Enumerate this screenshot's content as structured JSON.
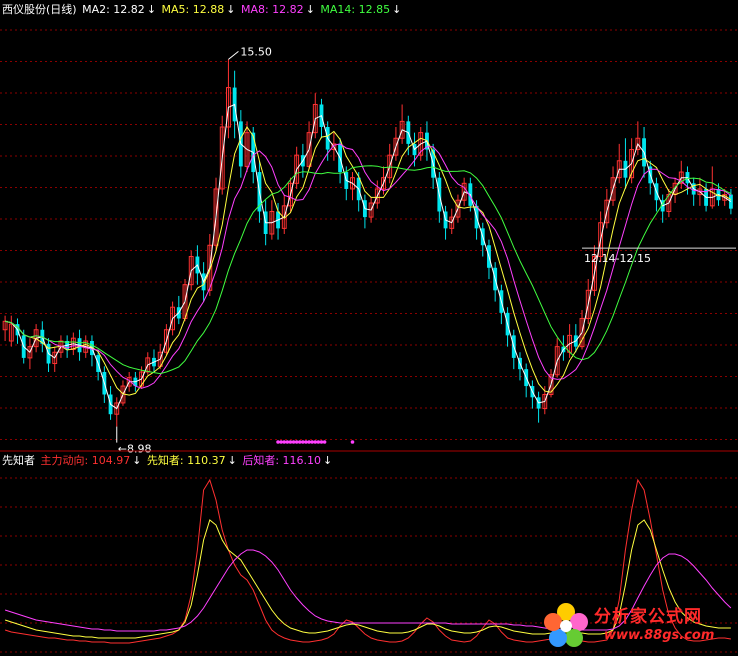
{
  "main_legend": {
    "title": "西仪股份(日线)",
    "items": [
      {
        "label": "MA2: 12.82",
        "color": "#ffffff"
      },
      {
        "label": "MA5: 12.88",
        "color": "#ffff40"
      },
      {
        "label": "MA8: 12.82",
        "color": "#ff40ff"
      },
      {
        "label": "MA14: 12.85",
        "color": "#40ff40"
      }
    ],
    "arrow": "↓"
  },
  "sub_legend": {
    "title": "先知者",
    "items": [
      {
        "label": "主力动向: 104.97",
        "color": "#ff3030"
      },
      {
        "label": "先知者: 110.37",
        "color": "#ffff40"
      },
      {
        "label": "后知者: 116.10",
        "color": "#ff40ff"
      }
    ],
    "arrow": "↓"
  },
  "annotations": {
    "high_label": "15.50",
    "low_label": "8.98",
    "range_label": "12.14-12.15"
  },
  "watermark": {
    "text": "分析家公式网",
    "url": "www.88gs.com"
  },
  "colors": {
    "up": "#ff3232",
    "down": "#00e5ee",
    "grid": "#8b0000",
    "divider": "#aa0000",
    "ma2": "#ffffff",
    "ma5": "#ffff40",
    "ma8": "#ff40ff",
    "ma14": "#40ff40",
    "main_force": "#ff3030",
    "prophet": "#ffff40",
    "follower": "#ff40ff",
    "dots": "#ff40ff"
  },
  "chart_data": [
    {
      "type": "candlestick",
      "title": "西仪股份(日线)",
      "ylim": [
        8.6,
        16.2
      ],
      "candles": [
        [
          10.7,
          10.85,
          10.5,
          10.95
        ],
        [
          10.5,
          10.8,
          10.4,
          10.95
        ],
        [
          10.8,
          10.6,
          10.45,
          10.9
        ],
        [
          10.6,
          10.2,
          10.1,
          10.7
        ],
        [
          10.2,
          10.4,
          10.0,
          10.55
        ],
        [
          10.4,
          10.7,
          10.3,
          10.8
        ],
        [
          10.7,
          10.45,
          10.3,
          10.85
        ],
        [
          10.45,
          10.1,
          9.95,
          10.55
        ],
        [
          10.1,
          10.3,
          9.95,
          10.4
        ],
        [
          10.3,
          10.5,
          10.2,
          10.6
        ],
        [
          10.5,
          10.35,
          10.2,
          10.6
        ],
        [
          10.35,
          10.55,
          10.25,
          10.65
        ],
        [
          10.55,
          10.3,
          10.15,
          10.7
        ],
        [
          10.3,
          10.5,
          10.2,
          10.6
        ],
        [
          10.5,
          10.25,
          10.05,
          10.6
        ],
        [
          10.25,
          9.95,
          9.8,
          10.35
        ],
        [
          9.95,
          9.55,
          9.4,
          10.05
        ],
        [
          9.55,
          9.2,
          9.1,
          9.7
        ],
        [
          9.2,
          9.4,
          8.98,
          9.5
        ],
        [
          9.4,
          9.7,
          9.35,
          9.8
        ],
        [
          9.7,
          9.85,
          9.6,
          9.95
        ],
        [
          9.85,
          9.7,
          9.6,
          9.95
        ],
        [
          9.7,
          9.95,
          9.65,
          10.05
        ],
        [
          9.95,
          10.2,
          9.9,
          10.3
        ],
        [
          10.2,
          10.05,
          9.95,
          10.35
        ],
        [
          10.05,
          10.3,
          10.0,
          10.45
        ],
        [
          10.3,
          10.7,
          10.25,
          10.8
        ],
        [
          10.7,
          11.1,
          10.6,
          11.2
        ],
        [
          11.1,
          10.9,
          10.8,
          11.3
        ],
        [
          10.9,
          11.5,
          10.85,
          11.6
        ],
        [
          11.5,
          12.0,
          11.4,
          12.1
        ],
        [
          12.0,
          11.7,
          11.5,
          12.2
        ],
        [
          11.7,
          11.4,
          11.2,
          11.9
        ],
        [
          11.4,
          12.2,
          11.3,
          12.4
        ],
        [
          12.2,
          13.2,
          12.1,
          13.4
        ],
        [
          13.2,
          14.3,
          13.1,
          14.5
        ],
        [
          14.3,
          15.0,
          14.1,
          15.5
        ],
        [
          15.0,
          14.4,
          14.1,
          15.3
        ],
        [
          14.4,
          13.6,
          13.4,
          14.6
        ],
        [
          13.6,
          14.2,
          13.5,
          14.4
        ],
        [
          14.2,
          13.5,
          13.3,
          14.3
        ],
        [
          13.5,
          12.8,
          12.6,
          13.7
        ],
        [
          12.8,
          12.4,
          12.2,
          13.0
        ],
        [
          12.4,
          12.8,
          12.3,
          13.0
        ],
        [
          12.8,
          12.5,
          12.3,
          12.95
        ],
        [
          12.5,
          12.9,
          12.4,
          13.1
        ],
        [
          12.9,
          13.3,
          12.8,
          13.4
        ],
        [
          13.3,
          13.8,
          13.2,
          13.95
        ],
        [
          13.8,
          13.6,
          13.4,
          14.0
        ],
        [
          13.6,
          14.2,
          13.55,
          14.4
        ],
        [
          14.2,
          14.7,
          14.1,
          14.9
        ],
        [
          14.7,
          14.3,
          14.1,
          14.8
        ],
        [
          14.3,
          13.9,
          13.7,
          14.4
        ],
        [
          13.9,
          14.0,
          13.7,
          14.2
        ],
        [
          14.0,
          13.5,
          13.3,
          14.1
        ],
        [
          13.5,
          13.2,
          13.0,
          13.6
        ],
        [
          13.2,
          13.4,
          13.0,
          13.5
        ],
        [
          13.4,
          13.0,
          12.8,
          13.5
        ],
        [
          13.0,
          12.7,
          12.5,
          13.1
        ],
        [
          12.7,
          12.95,
          12.6,
          13.05
        ],
        [
          12.95,
          13.2,
          12.85,
          13.35
        ],
        [
          13.2,
          13.4,
          13.1,
          13.6
        ],
        [
          13.4,
          13.8,
          13.3,
          14.0
        ],
        [
          13.8,
          14.1,
          13.7,
          14.3
        ],
        [
          14.1,
          14.4,
          14.0,
          14.7
        ],
        [
          14.4,
          14.0,
          13.8,
          14.5
        ],
        [
          14.0,
          13.8,
          13.6,
          14.2
        ],
        [
          13.8,
          14.2,
          13.7,
          14.3
        ],
        [
          14.2,
          13.9,
          13.7,
          14.4
        ],
        [
          13.9,
          13.4,
          13.2,
          14.0
        ],
        [
          13.4,
          12.8,
          12.6,
          13.5
        ],
        [
          12.8,
          12.5,
          12.3,
          12.9
        ],
        [
          12.5,
          12.7,
          12.4,
          12.85
        ],
        [
          12.7,
          13.0,
          12.6,
          13.1
        ],
        [
          13.0,
          13.3,
          12.9,
          13.4
        ],
        [
          13.3,
          12.9,
          12.8,
          13.4
        ],
        [
          12.9,
          12.5,
          12.3,
          13.0
        ],
        [
          12.5,
          12.2,
          12.0,
          12.6
        ],
        [
          12.2,
          11.8,
          11.6,
          12.3
        ],
        [
          11.8,
          11.4,
          11.2,
          11.9
        ],
        [
          11.4,
          11.0,
          10.8,
          11.5
        ],
        [
          11.0,
          10.6,
          10.4,
          11.1
        ],
        [
          10.6,
          10.2,
          10.0,
          10.7
        ],
        [
          10.2,
          10.0,
          9.8,
          10.3
        ],
        [
          10.0,
          9.7,
          9.5,
          10.1
        ],
        [
          9.7,
          9.5,
          9.3,
          9.8
        ],
        [
          9.5,
          9.3,
          9.05,
          9.6
        ],
        [
          9.3,
          9.55,
          9.2,
          9.7
        ],
        [
          9.55,
          9.9,
          9.5,
          10.0
        ],
        [
          9.9,
          10.4,
          9.85,
          10.55
        ],
        [
          10.4,
          10.3,
          10.15,
          10.6
        ],
        [
          10.3,
          10.6,
          10.2,
          10.8
        ],
        [
          10.6,
          10.4,
          10.3,
          10.8
        ],
        [
          10.4,
          10.9,
          10.35,
          11.05
        ],
        [
          10.9,
          11.4,
          10.8,
          11.6
        ],
        [
          11.4,
          12.0,
          11.3,
          12.2
        ],
        [
          12.0,
          12.6,
          11.9,
          12.8
        ],
        [
          12.6,
          13.0,
          12.5,
          13.2
        ],
        [
          13.0,
          13.4,
          12.9,
          13.6
        ],
        [
          13.4,
          13.7,
          13.3,
          14.0
        ],
        [
          13.7,
          13.4,
          13.2,
          14.1
        ],
        [
          13.4,
          13.9,
          13.3,
          14.1
        ],
        [
          13.9,
          14.1,
          13.8,
          14.4
        ],
        [
          14.1,
          13.6,
          13.4,
          14.3
        ],
        [
          13.6,
          13.3,
          13.1,
          13.7
        ],
        [
          13.3,
          13.0,
          12.8,
          13.4
        ],
        [
          13.0,
          12.8,
          12.6,
          13.1
        ],
        [
          12.8,
          13.1,
          12.7,
          13.2
        ],
        [
          13.1,
          13.3,
          12.95,
          13.4
        ],
        [
          13.3,
          13.5,
          13.2,
          13.7
        ],
        [
          13.5,
          13.3,
          13.1,
          13.6
        ],
        [
          13.3,
          13.1,
          12.9,
          13.4
        ],
        [
          13.1,
          13.2,
          12.9,
          13.4
        ],
        [
          13.2,
          12.9,
          12.8,
          13.3
        ],
        [
          12.9,
          13.2,
          12.85,
          13.6
        ],
        [
          13.2,
          13.0,
          12.9,
          13.3
        ],
        [
          13.0,
          13.1,
          12.9,
          13.2
        ],
        [
          13.1,
          12.85,
          12.75,
          13.2
        ]
      ],
      "ma_periods": {
        "MA2": 2,
        "MA5": 5,
        "MA8": 8,
        "MA14": 14
      },
      "range_price": 12.15,
      "signal_dots_index_range": [
        44,
        51
      ],
      "signal_dot_extra": 56
    },
    {
      "type": "line",
      "title": "先知者",
      "ylim": [
        0,
        180
      ],
      "series": [
        {
          "name": "主力动向",
          "values": [
            20,
            18,
            17,
            16,
            15,
            14,
            13,
            12,
            12,
            11,
            10,
            10,
            9,
            9,
            8,
            8,
            8,
            7,
            7,
            7,
            7,
            8,
            9,
            10,
            11,
            12,
            14,
            16,
            20,
            30,
            55,
            100,
            160,
            170,
            150,
            120,
            100,
            85,
            75,
            70,
            60,
            45,
            30,
            20,
            15,
            12,
            10,
            9,
            8,
            8,
            9,
            10,
            12,
            16,
            24,
            30,
            28,
            22,
            16,
            12,
            10,
            9,
            8,
            8,
            9,
            12,
            18,
            26,
            32,
            28,
            20,
            14,
            10,
            9,
            8,
            9,
            14,
            22,
            30,
            26,
            18,
            12,
            10,
            9,
            8,
            8,
            9,
            10,
            11,
            12,
            12,
            11,
            10,
            9,
            8,
            8,
            9,
            10,
            20,
            50,
            100,
            140,
            170,
            160,
            130,
            95,
            60,
            35,
            22,
            14,
            10,
            9,
            9,
            10,
            11,
            12,
            12,
            11
          ]
        },
        {
          "name": "先知者",
          "values": [
            30,
            28,
            26,
            24,
            22,
            20,
            19,
            18,
            17,
            16,
            15,
            14,
            14,
            13,
            13,
            12,
            12,
            12,
            12,
            12,
            12,
            12,
            13,
            14,
            15,
            16,
            17,
            18,
            20,
            28,
            45,
            75,
            110,
            130,
            125,
            110,
            100,
            95,
            90,
            80,
            70,
            60,
            50,
            40,
            32,
            26,
            22,
            20,
            18,
            17,
            17,
            18,
            19,
            21,
            23,
            25,
            26,
            25,
            23,
            21,
            19,
            18,
            17,
            17,
            17,
            18,
            20,
            23,
            26,
            26,
            24,
            21,
            19,
            18,
            17,
            17,
            18,
            20,
            23,
            24,
            23,
            21,
            19,
            18,
            17,
            16,
            16,
            16,
            17,
            17,
            18,
            18,
            17,
            17,
            16,
            16,
            16,
            17,
            20,
            35,
            65,
            100,
            125,
            130,
            120,
            100,
            80,
            62,
            48,
            38,
            32,
            28,
            26,
            24,
            23,
            22,
            22,
            22
          ]
        },
        {
          "name": "后知者",
          "values": [
            40,
            38,
            36,
            34,
            32,
            30,
            29,
            28,
            27,
            26,
            25,
            24,
            23,
            22,
            21,
            21,
            20,
            20,
            19,
            19,
            19,
            19,
            19,
            19,
            19,
            20,
            20,
            21,
            22,
            24,
            28,
            34,
            42,
            52,
            62,
            72,
            82,
            90,
            96,
            100,
            100,
            98,
            94,
            88,
            80,
            70,
            60,
            52,
            45,
            39,
            34,
            31,
            29,
            28,
            27,
            27,
            27,
            27,
            27,
            27,
            27,
            27,
            27,
            27,
            27,
            27,
            27,
            27,
            27,
            27,
            27,
            27,
            26,
            26,
            26,
            26,
            26,
            26,
            26,
            26,
            26,
            26,
            25,
            25,
            24,
            24,
            23,
            22,
            21,
            21,
            20,
            20,
            20,
            20,
            20,
            20,
            20,
            20,
            21,
            24,
            30,
            40,
            52,
            64,
            75,
            85,
            92,
            96,
            96,
            94,
            90,
            84,
            77,
            70,
            62,
            55,
            48,
            42
          ]
        }
      ]
    }
  ]
}
